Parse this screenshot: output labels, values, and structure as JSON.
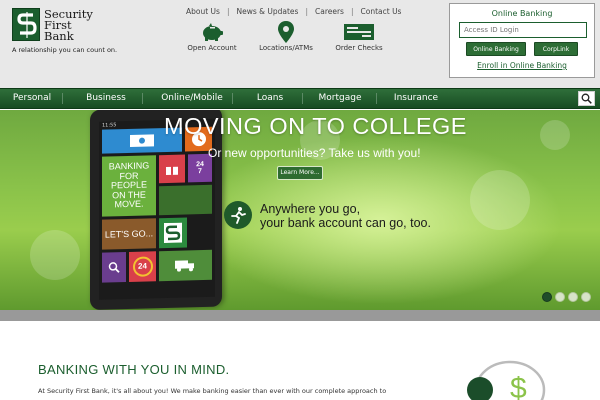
{
  "brand": {
    "name": "Security\nFirst\nBank",
    "tagline": "A relationship you can count on.",
    "color": "#1b5e2e"
  },
  "top_links": [
    "About Us",
    "News & Updates",
    "Careers",
    "Contact Us"
  ],
  "quick_links": [
    {
      "label": "Open Account",
      "icon": "piggy-bank-icon"
    },
    {
      "label": "Locations/ATMs",
      "icon": "map-pin-icon"
    },
    {
      "label": "Order Checks",
      "icon": "check-icon"
    }
  ],
  "online_banking": {
    "title": "Online Banking",
    "input_placeholder": "Access ID Login",
    "buttons": [
      "Online Banking",
      "CorpLink"
    ],
    "enroll": "Enroll in Online Banking"
  },
  "nav": {
    "items": [
      "Personal",
      "Business",
      "Online/Mobile",
      "Loans",
      "Mortgage",
      "Insurance"
    ],
    "search_icon": "search-icon"
  },
  "hero": {
    "title": "MOVING ON TO COLLEGE",
    "subtitle": "Or new opportunities? Take us with you!",
    "button": "Learn More...",
    "slogan": "Anywhere you go,\nyour bank account can go, too.",
    "slide_count": 4,
    "active_slide": 1,
    "phone": {
      "time": "11:55",
      "tile_banking": "BANKING\nFOR\nPEOPLE\nON THE\nMOVE.",
      "tile_247": "24\n7",
      "tile_go": "LET'S GO...",
      "tile_24": "24"
    }
  },
  "section": {
    "title": "BANKING WITH YOU IN MIND.",
    "text": "At Security First Bank, it's all about you! We make banking easier than ever with our complete approach to"
  }
}
